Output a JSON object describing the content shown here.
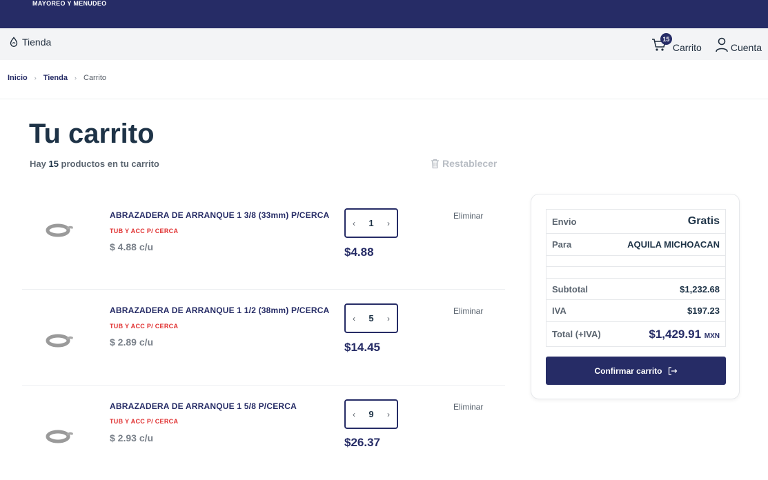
{
  "header": {
    "brand": "MAYOREO Y MENUDEO"
  },
  "nav": {
    "tienda_label": "Tienda",
    "cart_label": "Carrito",
    "cart_count": "15",
    "account_label": "Cuenta"
  },
  "breadcrumb": {
    "home": "Inicio",
    "store": "Tienda",
    "current": "Carrito"
  },
  "page": {
    "title": "Tu carrito",
    "subtitle_prefix": "Hay ",
    "count": "15",
    "subtitle_suffix": " productos en tu carrito",
    "reset_label": "Restablecer"
  },
  "items": [
    {
      "name": "ABRAZADERA DE ARRANQUE 1 3/8 (33mm) P/CERCA",
      "category": "TUB Y ACC P/ CERCA",
      "unit_price": "$ 4.88 c/u",
      "qty": "1",
      "total": "$4.88",
      "remove": "Eliminar"
    },
    {
      "name": "ABRAZADERA DE ARRANQUE 1 1/2 (38mm) P/CERCA",
      "category": "TUB Y ACC P/ CERCA",
      "unit_price": "$ 2.89 c/u",
      "qty": "5",
      "total": "$14.45",
      "remove": "Eliminar"
    },
    {
      "name": "ABRAZADERA DE ARRANQUE 1 5/8 P/CERCA",
      "category": "TUB Y ACC P/ CERCA",
      "unit_price": "$ 2.93 c/u",
      "qty": "9",
      "total": "$26.37",
      "remove": "Eliminar"
    }
  ],
  "summary": {
    "envio_label": "Envio",
    "envio_value": "Gratis",
    "para_label": "Para",
    "para_value": "AQUILA MICHOACAN",
    "subtotal_label": "Subtotal",
    "subtotal_value": "$1,232.68",
    "iva_label": "IVA",
    "iva_value": "$197.23",
    "total_label": "Total (+IVA)",
    "total_value": "$1,429.91",
    "currency": "MXN",
    "confirm_label": "Confirmar carrito"
  },
  "colors": {
    "brand": "#262c66",
    "category": "#e03030",
    "muted": "#b8bdc4"
  },
  "icons": [
    "drop-icon",
    "cart-icon",
    "user-icon",
    "trash-icon",
    "logout-arrow-icon",
    "clamp-product-image"
  ]
}
